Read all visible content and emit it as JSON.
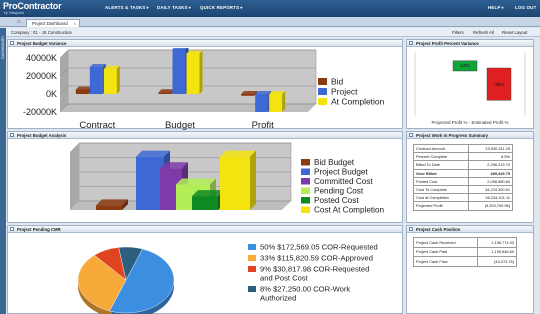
{
  "app": {
    "logo_text": "ProContractor",
    "logo_sub": "by Viewpoint"
  },
  "nav": [
    {
      "label": "ALERTS & TASKS"
    },
    {
      "label": "DAILY TASKS"
    },
    {
      "label": "QUICK REPORTS"
    },
    {
      "label": "HELP"
    },
    {
      "label": "LOG OUT"
    }
  ],
  "tab": {
    "label": "Project Dashboard",
    "close": "×"
  },
  "company_bar": {
    "company": "Company : 01 - JS Construction",
    "links": [
      "Filters",
      "Refresh All",
      "Reset Layout"
    ]
  },
  "side_strip": {
    "label": "DASHBOARD"
  },
  "panels": {
    "budget_variance": {
      "title": "Project Budget Variance"
    },
    "profit_variance": {
      "title": "Project Profit Percent Variance"
    },
    "budget_analysis": {
      "title": "Project Budget Analysis"
    },
    "wip_summary": {
      "title": "Project Work In Progress Summary"
    },
    "pending_cmr": {
      "title": "Project Pending CMR"
    },
    "cash_position": {
      "title": "Project Cash Position"
    }
  },
  "chart_data": [
    {
      "type": "bar",
      "name": "Project Budget Variance",
      "categories": [
        "Contract",
        "Budget",
        "Profit"
      ],
      "series": [
        {
          "name": "Bid",
          "color": "#8b3a10",
          "values": [
            5000,
            2000,
            -2000
          ]
        },
        {
          "name": "Project",
          "color": "#3e68d4",
          "values": [
            30000,
            50000,
            -20000
          ]
        },
        {
          "name": "At Completion",
          "color": "#f3e30f",
          "values": [
            28000,
            45000,
            -20000
          ]
        }
      ],
      "ylim": [
        -20000,
        40000
      ],
      "ytick_labels": [
        "40000K",
        "20000K",
        "0K",
        "-20000K"
      ],
      "legend": "right",
      "grid": true
    },
    {
      "type": "bar",
      "name": "Project Profit Percent Variance",
      "categories": [
        "Projected Profit %",
        "Estimated Profit %"
      ],
      "series": [
        {
          "name": "Projected Profit %",
          "color": "#0fa33a",
          "values": [
            12
          ]
        },
        {
          "name": "Estimated Profit %",
          "color": "#e02020",
          "values": [
            -38
          ]
        }
      ],
      "data_labels": [
        "12%",
        "-38%"
      ],
      "xlabel": "Projected Profit % - Estimated Profit %"
    },
    {
      "type": "bar",
      "name": "Project Budget Analysis",
      "categories": [
        "Bid Budget",
        "Project Budget",
        "Committed Cost",
        "Pending Cost",
        "Posted Cost",
        "Cost At Completion"
      ],
      "series": [
        {
          "name": "Bid Budget",
          "color": "#8b3a10",
          "values": [
            4
          ]
        },
        {
          "name": "Project Budget",
          "color": "#3e68d4",
          "values": [
            46
          ]
        },
        {
          "name": "Committed Cost",
          "color": "#7e3aa8",
          "values": [
            36
          ]
        },
        {
          "name": "Pending Cost",
          "color": "#b3ee57",
          "values": [
            22
          ]
        },
        {
          "name": "Posted Cost",
          "color": "#0e8a22",
          "values": [
            12
          ]
        },
        {
          "name": "Cost At Completion",
          "color": "#f3e30f",
          "values": [
            46
          ]
        }
      ],
      "legend": "right",
      "grid": true
    },
    {
      "type": "pie",
      "name": "Project Pending CMR",
      "slices": [
        {
          "pct": "50%",
          "amount": "$172,569.05",
          "label": "COR-Requested",
          "value": 50,
          "color": "#3c8ee0"
        },
        {
          "pct": "33%",
          "amount": "$115,820.59",
          "label": "COR-Approved",
          "value": 33,
          "color": "#f7a93a"
        },
        {
          "pct": "9%",
          "amount": "$30,817.98",
          "label": "COR-Requested and Post Cost",
          "value": 9,
          "color": "#e0431f"
        },
        {
          "pct": "8%",
          "amount": "$27,250.00",
          "label": "COR-Work Authorized",
          "value": 8,
          "color": "#2c5f7f"
        }
      ],
      "legend": "right"
    }
  ],
  "wip": {
    "rows": [
      {
        "label": "Contract Amount",
        "value": "23,930,311.25",
        "bold": false
      },
      {
        "label": "Percent Complete",
        "value": "8.5%",
        "bold": false
      },
      {
        "label": "Billed To Date",
        "value": "2,296,219.70",
        "bold": false
      },
      {
        "label": "Over Billed",
        "value": "289,429.75",
        "bold": true
      },
      {
        "label": "Posted Cost",
        "value": "2,008,880.60",
        "bold": false
      },
      {
        "label": "Cost To Complete",
        "value": "34,224,300.51",
        "bold": false
      },
      {
        "label": "Cost at Completion",
        "value": "36,234,101.11",
        "bold": false
      },
      {
        "label": "Projected Profit",
        "value": "(5,303,790.96)",
        "bold": false
      }
    ]
  },
  "cash": {
    "rows": [
      {
        "label": "Project Cash Received",
        "value": "1,156,774.93"
      },
      {
        "label": "Project Cash Paid",
        "value": "1,199,848.69"
      },
      {
        "label": "Project Cash Flow",
        "value": "(43,073.76)"
      }
    ]
  }
}
